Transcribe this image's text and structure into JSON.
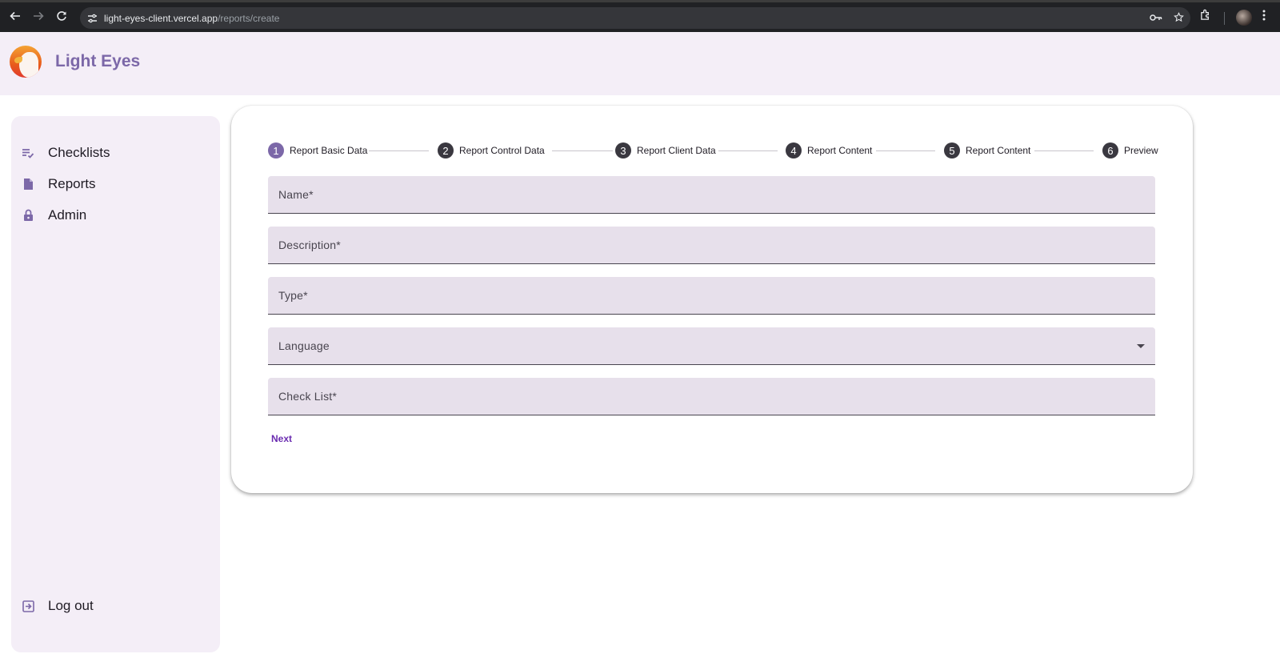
{
  "browser": {
    "url_host": "light-eyes-client.vercel.app",
    "url_path": "/reports/create",
    "icons": {
      "back": "arrow-left-icon",
      "forward": "arrow-right-icon",
      "reload": "reload-icon",
      "site_info": "tune-icon",
      "password": "key-icon",
      "bookmark": "star-icon",
      "extensions": "puzzle-icon",
      "menu": "kebab-menu-icon"
    }
  },
  "app": {
    "title": "Light Eyes",
    "accent_color": "#7c68a8"
  },
  "sidebar": {
    "items": [
      {
        "label": "Checklists",
        "icon": "checklist-icon"
      },
      {
        "label": "Reports",
        "icon": "document-icon"
      },
      {
        "label": "Admin",
        "icon": "lock-icon"
      }
    ],
    "logout": {
      "label": "Log out",
      "icon": "logout-icon"
    }
  },
  "stepper": {
    "active_index": 0,
    "steps": [
      {
        "num": "1",
        "label": "Report Basic Data"
      },
      {
        "num": "2",
        "label": "Report Control Data"
      },
      {
        "num": "3",
        "label": "Report Client Data"
      },
      {
        "num": "4",
        "label": "Report Content"
      },
      {
        "num": "5",
        "label": "Report Content"
      },
      {
        "num": "6",
        "label": "Preview"
      }
    ]
  },
  "form": {
    "fields": [
      {
        "label": "Name*",
        "value": ""
      },
      {
        "label": "Description*",
        "value": ""
      },
      {
        "label": "Type*",
        "value": ""
      },
      {
        "label": "Language",
        "value": "",
        "type": "select"
      },
      {
        "label": "Check List*",
        "value": ""
      }
    ],
    "next_label": "Next"
  }
}
